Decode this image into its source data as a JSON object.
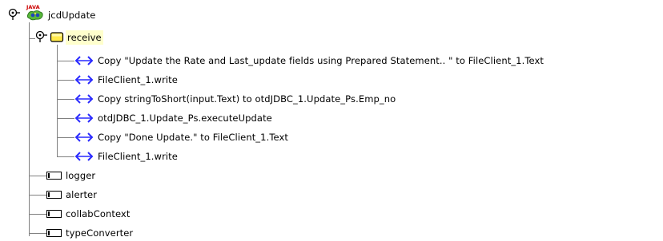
{
  "tree": {
    "root": {
      "label": "jcdUpdate",
      "icon": "java-collaboration-icon",
      "icon_text": "JAVA"
    },
    "receive": {
      "label": "receive",
      "icon": "folder-icon",
      "selected": true,
      "highlight_color": "#ffffcc"
    },
    "statements": [
      {
        "label": "Copy \"Update the Rate and Last_update fields using Prepared Statement.. \" to FileClient_1.Text"
      },
      {
        "label": "FileClient_1.write"
      },
      {
        "label": "Copy stringToShort(input.Text) to otdJDBC_1.Update_Ps.Emp_no"
      },
      {
        "label": "otdJDBC_1.Update_Ps.executeUpdate"
      },
      {
        "label": "Copy \"Done Update.\" to FileClient_1.Text"
      },
      {
        "label": "FileClient_1.write"
      }
    ],
    "fields": [
      {
        "label": "logger"
      },
      {
        "label": "alerter"
      },
      {
        "label": "collabContext"
      },
      {
        "label": "typeConverter"
      }
    ],
    "colors": {
      "arrow_icon": "#2a2aff",
      "tree_lines": "#808080",
      "folder_fill": "#ffe94a"
    }
  }
}
